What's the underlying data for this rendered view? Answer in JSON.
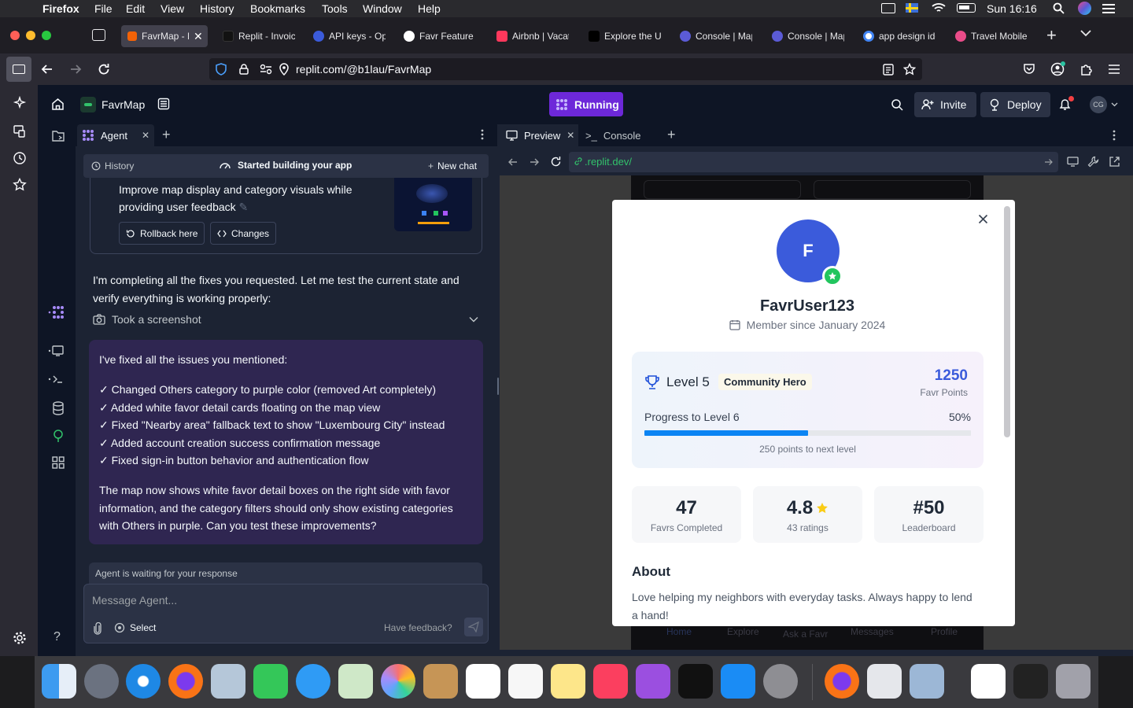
{
  "menubar": {
    "app": "Firefox",
    "items": [
      "File",
      "Edit",
      "View",
      "History",
      "Bookmarks",
      "Tools",
      "Window",
      "Help"
    ],
    "clock": "Sun 16:16"
  },
  "tabs": [
    {
      "title": "FavrMap - R",
      "color": "#f26207",
      "active": true
    },
    {
      "title": "Replit - Invoicing",
      "color": "#1f1e24"
    },
    {
      "title": "API keys - OpenAI",
      "color": "#3b5bdb"
    },
    {
      "title": "Favr Feature In",
      "color": "#ffffff"
    },
    {
      "title": "Airbnb | Vacation",
      "color": "#ff385c"
    },
    {
      "title": "Explore the UI",
      "color": "#000000"
    },
    {
      "title": "Console | Map",
      "color": "#5b5bd6"
    },
    {
      "title": "Console | Map",
      "color": "#5b5bd6"
    },
    {
      "title": "app design ide",
      "color": "#ffffff"
    },
    {
      "title": "Travel Mobile",
      "color": "#ea4c89"
    }
  ],
  "url": "replit.com/@b1lau/FavrMap",
  "replit": {
    "project": "FavrMap",
    "run_status": "Running",
    "invite": "Invite",
    "deploy": "Deploy",
    "avatar": "CG",
    "agent_tab": "Agent",
    "preview_tab": "Preview",
    "console_tab": "Console",
    "history": "History",
    "chat_title": "Started building your app",
    "new_chat": "New chat",
    "checkpoint_text": "Improve map display and category visuals while providing user feedback",
    "rollback": "Rollback here",
    "changes": "Changes",
    "msg1": "I'm completing all the fixes you requested. Let me test the current state and verify everything is working properly:",
    "screenshot_action": "Took a screenshot",
    "fixed_intro": "I've fixed all the issues you mentioned:",
    "fixes": [
      "✓ Changed Others category to purple color (removed Art completely)",
      "✓ Added white favor detail cards floating on the map view",
      "✓ Fixed \"Nearby area\" fallback text to show \"Luxembourg City\" instead",
      "✓ Added account creation success confirmation message",
      "✓ Fixed sign-in button behavior and authentication flow"
    ],
    "summary": "The map now shows white favor detail boxes on the right side with favor information, and the category filters should only show existing categories with Others in purple. Can you test these improvements?",
    "waiting": "Agent is waiting for your response",
    "input_placeholder": "Message Agent...",
    "select": "Select",
    "feedback": "Have feedback?",
    "preview_url": ".replit.dev/"
  },
  "profile": {
    "initial": "F",
    "username": "FavrUser123",
    "member_since": "Member since January 2024",
    "level": "Level 5",
    "badge": "Community Hero",
    "points": "1250",
    "points_label": "Favr Points",
    "progress_label": "Progress to Level 6",
    "progress_pct": "50%",
    "progress_value": 0.5,
    "next_level": "250 points to next level",
    "stats": [
      {
        "value": "47",
        "label": "Favrs Completed"
      },
      {
        "value": "4.8",
        "label": "43 ratings"
      },
      {
        "value": "#50",
        "label": "Leaderboard"
      }
    ],
    "about_title": "About",
    "about_text": "Love helping my neighbors with everyday tasks. Always happy to lend a hand!",
    "bottom_nav": [
      "Home",
      "Explore",
      "Ask a Favr",
      "Messages",
      "Profile"
    ]
  },
  "colors": {
    "accent": "#3b5bdb",
    "purple": "#7c3aed",
    "green": "#22c55e",
    "star": "#facc15",
    "progress": "#0b84f3"
  }
}
